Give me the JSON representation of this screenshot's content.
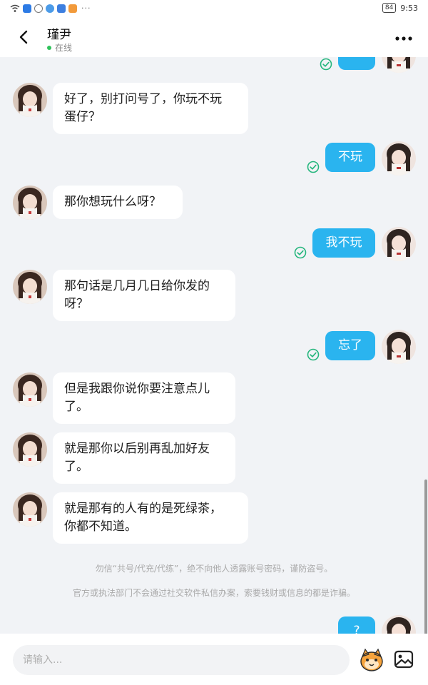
{
  "status_bar": {
    "time": "9:53",
    "battery": "84",
    "dots": "···"
  },
  "header": {
    "title": "瑾尹",
    "status": "在线",
    "back_icon": "chevron-left-icon",
    "more_icon": "more-dots-icon"
  },
  "colors": {
    "bubble_out": "#2ab4ef",
    "bubble_in": "#ffffff",
    "check": "#25b67d",
    "online": "#2fc25b"
  },
  "messages": [
    {
      "dir": "out",
      "text": ""
    },
    {
      "dir": "in",
      "line1": "好了，别打问号了，你玩不玩",
      "line2": "蛋仔？"
    },
    {
      "dir": "out",
      "text": "不玩"
    },
    {
      "dir": "in",
      "line1": "那你想玩什么呀？"
    },
    {
      "dir": "out",
      "text": "我不玩"
    },
    {
      "dir": "in",
      "line1": "那句话是几月几日给你发的",
      "line2": "呀？"
    },
    {
      "dir": "out",
      "text": "忘了"
    },
    {
      "dir": "in",
      "line1": "但是我跟你说你要注意点儿",
      "line2": "了。"
    },
    {
      "dir": "in",
      "line1": "就是那你以后别再乱加好友",
      "line2": "了。"
    },
    {
      "dir": "in",
      "line1": "就是那有的人有的是死绿茶，",
      "line2": "你都不知道。"
    },
    {
      "dir": "out",
      "text": "?"
    }
  ],
  "notices": [
    "勿信“共号/代充/代练”，绝不向他人透露账号密码，谨防盗号。",
    "官方或执法部门不会通过社交软件私信办案，索要钱财或信息的都是诈骗。"
  ],
  "input": {
    "placeholder": "请输入..."
  }
}
